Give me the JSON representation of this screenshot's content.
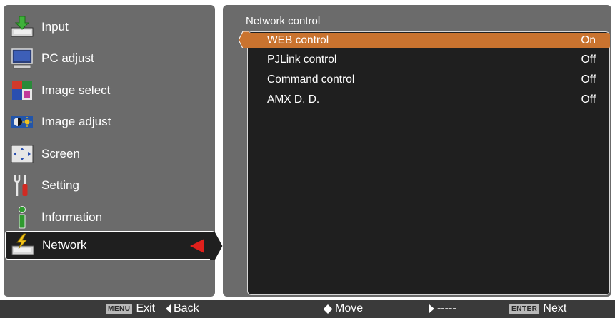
{
  "menu": {
    "items": [
      {
        "label": "Input",
        "icon": "input-icon"
      },
      {
        "label": "PC adjust",
        "icon": "monitor-icon"
      },
      {
        "label": "Image select",
        "icon": "image-select-icon"
      },
      {
        "label": "Image adjust",
        "icon": "image-adjust-icon"
      },
      {
        "label": "Screen",
        "icon": "screen-icon"
      },
      {
        "label": "Setting",
        "icon": "wrench-icon"
      },
      {
        "label": "Information",
        "icon": "info-icon"
      },
      {
        "label": "Network",
        "icon": "network-icon"
      }
    ],
    "selected_index": 7
  },
  "submenu": {
    "title": "Network control",
    "rows": [
      {
        "label": "WEB control",
        "value": "On"
      },
      {
        "label": "PJLink control",
        "value": "Off"
      },
      {
        "label": "Command control",
        "value": "Off"
      },
      {
        "label": "AMX D. D.",
        "value": "Off"
      }
    ],
    "selected_index": 0
  },
  "footer": {
    "exit_key": "MENU",
    "exit_label": "Exit",
    "back_label": "Back",
    "move_label": "Move",
    "right_label": "-----",
    "next_key": "ENTER",
    "next_label": "Next"
  },
  "colors": {
    "panel": "#6b6b6b",
    "dark": "#1f1f1f",
    "highlight": "#c9732f",
    "arrow": "#e0201c"
  }
}
